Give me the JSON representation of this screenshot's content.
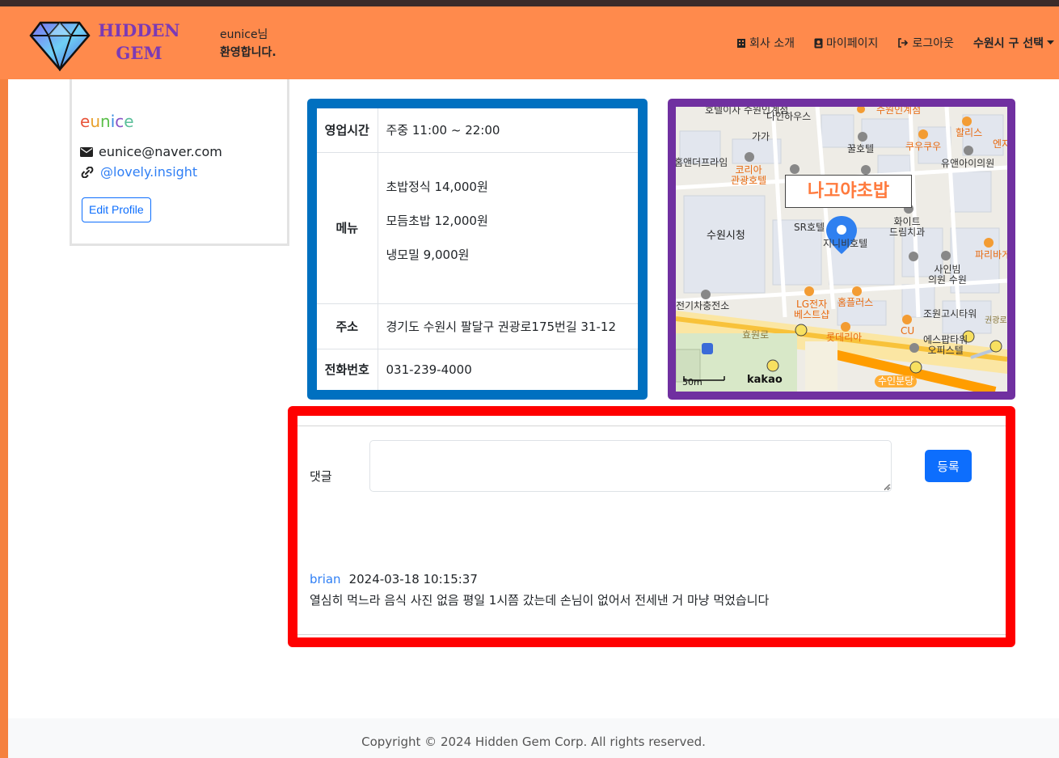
{
  "brand": {
    "line1": "HIDDEN",
    "line2": "GEM"
  },
  "user": {
    "greeting_name": "eunice님",
    "greeting_text": "환영합니다.",
    "name": "eunice",
    "email": "eunice@naver.com",
    "link": "@lovely.insight",
    "edit_label": "Edit Profile"
  },
  "nav": {
    "about": "회사 소개",
    "mypage": "마이페이지",
    "logout": "로그아웃",
    "region": "수원시 구 선택"
  },
  "info": {
    "hours_label": "영업시간",
    "hours": "주중 11:00 ~ 22:00",
    "menu_label": "메뉴",
    "menu": [
      "초밥정식 14,000원",
      "모듬초밥 12,000원",
      "냉모밀 9,000원"
    ],
    "address_label": "주소",
    "address": "경기도 수원시 팔달구 권광로175번길 31-12",
    "phone_label": "전화번호",
    "phone": "031-239-4000"
  },
  "map": {
    "place": "나고야초밥",
    "labels": {
      "l1": "호텔이자\n수원인계점",
      "l2": "다인하우스",
      "l3": "수원인계점",
      "l4": "가가",
      "l5": "꿀호텔",
      "l6": "쿠우쿠우",
      "l7": "할리스",
      "l8": "엔지",
      "l9": "유앤아이의원",
      "l10": "홈앤더프라임",
      "l11": "코리아\n관광호텔",
      "l12": "수원시청",
      "l13": "SR호텔",
      "l14": "지니비호텔",
      "l15": "화이트\n드림치과",
      "l16": "파리바게",
      "l17": "사인빔\n의원 수원",
      "l18": "전기차충전소",
      "l19": "LG전자\n베스트샵",
      "l20": "홈플러스",
      "l21": "조원고시타워",
      "l22": "롯데리아",
      "l23": "CU",
      "l24": "에스팝타워\n오피스텔",
      "l25": "효원로",
      "l26": "수인분당",
      "l27": "권광로"
    },
    "scale": "50m",
    "provider": "kakao"
  },
  "comments": {
    "label": "댓글",
    "submit": "등록",
    "items": [
      {
        "user": "brian",
        "date": "2024-03-18 10:15:37",
        "text": "열심히 먹느라 음식 사진 없음 평일 1시쯤 갔는데 손님이 없어서 전세낸 거 마냥 먹었습니다"
      }
    ]
  },
  "footer": {
    "copyright": "Copyright © 2024 Hidden Gem Corp. All rights reserved."
  },
  "colors": {
    "navbar": "#ff8a4c",
    "info_border": "#0070c0",
    "map_border": "#7030a0",
    "comment_border": "#ff0000",
    "primary": "#0d6efd"
  }
}
